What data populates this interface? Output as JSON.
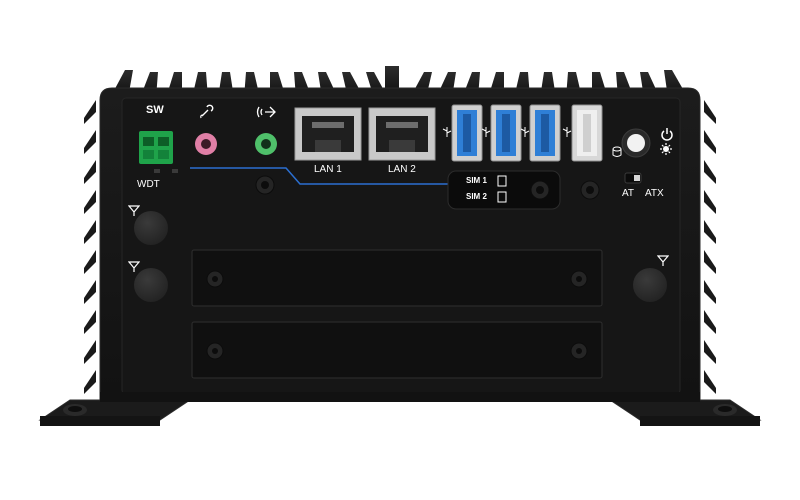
{
  "device": {
    "description_free": true,
    "colors": {
      "chassis": "#171717",
      "chassis_edge": "#2a2a2a",
      "terminal_green": "#1fa34a",
      "mic_pink": "#e07fa6",
      "line_green": "#4fc06a",
      "usb3_blue": "#2f7fd6",
      "trace_blue": "#2b6fd1",
      "label_white": "#ffffff"
    },
    "labels": {
      "sw": "SW",
      "wdt": "WDT",
      "lan1": "LAN 1",
      "lan2": "LAN 2",
      "sim1": "SIM 1",
      "sim2": "SIM 2",
      "at": "AT",
      "atx": "ATX"
    },
    "icons": [
      "microphone-icon",
      "line-out-icon",
      "usb3-icon",
      "usb-icon",
      "power-icon",
      "antenna-icon",
      "hdd-led-icon",
      "reset-icon"
    ]
  }
}
